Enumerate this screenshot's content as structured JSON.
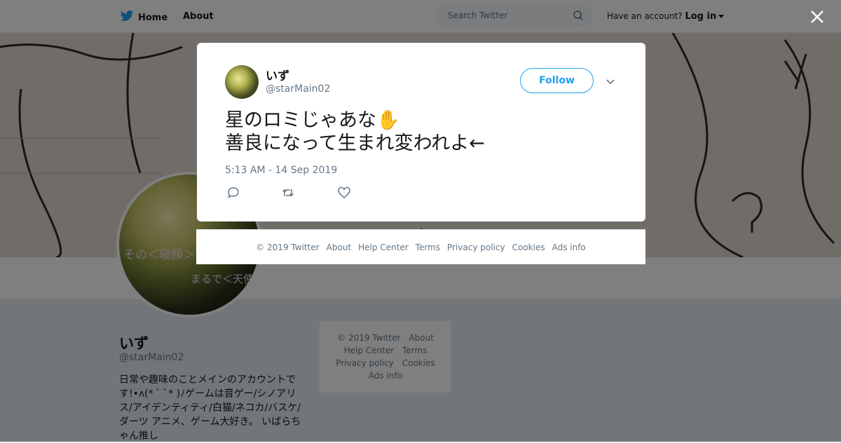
{
  "nav": {
    "home_label": "Home",
    "about_label": "About",
    "search_placeholder": "Search Twitter",
    "account_prompt": "Have an account?",
    "login_label": "Log in"
  },
  "colors": {
    "brand_blue": "#1da1f2",
    "text_primary": "#14171a",
    "text_secondary": "#657786",
    "page_bg": "#e6ecf0"
  },
  "profile": {
    "avatar_text_line1": "その＜寝顔＞",
    "avatar_text_line2": "まるで＜天使",
    "name": "いず",
    "handle": "@starMain02",
    "bio": "日常や趣味のことメインのアカウントです!•ʌ(* ﾟ ﾟ* )ﾉゲームは音ゲー/シノアリス/アイデンティティ/白猫/ネコカ/バスケ/ダーツ アニメ、ゲーム大好き。 いばらちゃん推し"
  },
  "side_footer": {
    "links": [
      "© 2019 Twitter",
      "About",
      "Help Center",
      "Terms",
      "Privacy policy",
      "Cookies",
      "Ads info"
    ]
  },
  "tweet": {
    "author_name": "いず",
    "author_handle": "@starMain02",
    "follow_label": "Follow",
    "text_line1": "星のロミじゃあな✋",
    "text_line2": "善良になって生まれ変われよ←",
    "timestamp": "5:13 AM - 14 Sep 2019",
    "icons": [
      "reply-icon",
      "retweet-icon",
      "like-icon",
      "chevron-down-icon"
    ]
  },
  "modal_footer": {
    "links": [
      "© 2019 Twitter",
      "About",
      "Help Center",
      "Terms",
      "Privacy policy",
      "Cookies",
      "Ads info"
    ]
  }
}
